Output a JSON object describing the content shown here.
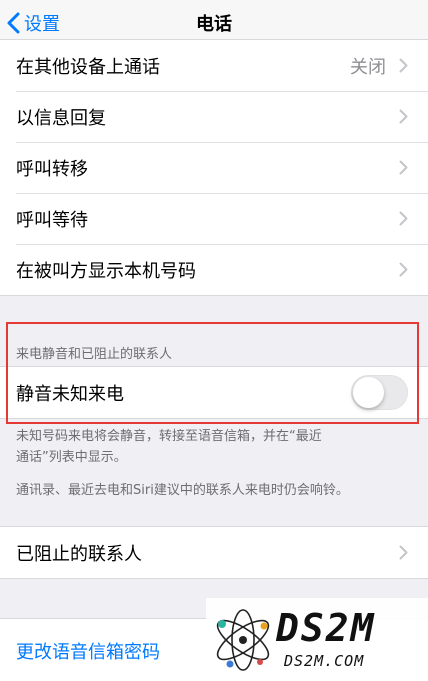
{
  "navbar": {
    "back_label": "设置",
    "title": "电话"
  },
  "group1": {
    "items": [
      {
        "label": "在其他设备上通话",
        "value": "关闭"
      },
      {
        "label": "以信息回复"
      },
      {
        "label": "呼叫转移"
      },
      {
        "label": "呼叫等待"
      },
      {
        "label": "在被叫方显示本机号码"
      }
    ]
  },
  "silence_section": {
    "header": "来电静音和已阻止的联系人",
    "toggle_label": "静音未知来电",
    "toggle_on": false,
    "footer_line1": "未知号码来电将会静音，转接至语音信箱，并在“最近",
    "footer_line2": "通话”列表中显示。",
    "footer_note": "通讯录、最近去电和Siri建议中的联系人来电时仍会响铃。"
  },
  "blocked": {
    "label": "已阻止的联系人"
  },
  "voicemail": {
    "label": "更改语音信箱密码"
  },
  "watermark": {
    "brand": "DS2M",
    "site": "DS2M.COM"
  },
  "colors": {
    "accent": "#007aff",
    "highlight": "#e53935"
  }
}
